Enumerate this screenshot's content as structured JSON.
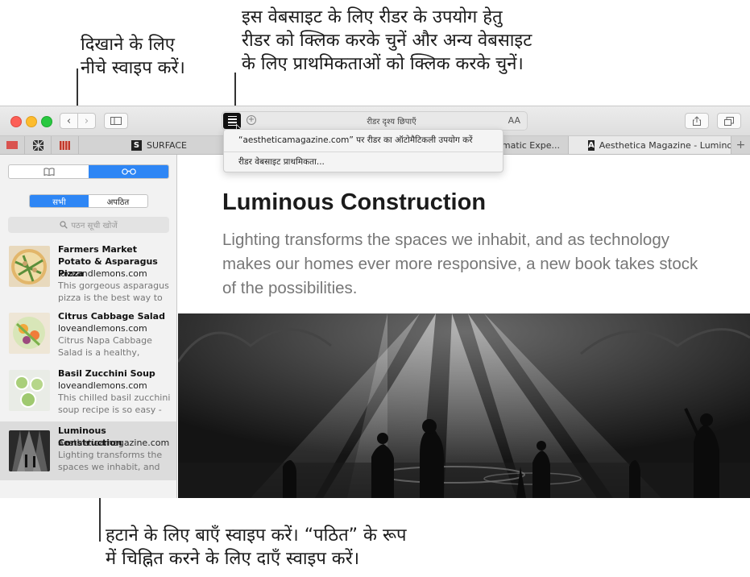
{
  "callouts": {
    "top_left": [
      "दिखाने के लिए",
      "नीचे स्वाइप करें।"
    ],
    "top_right": [
      "इस वेबसाइट के लिए रीडर के उपयोग हेतु",
      "रीडर को क्लिक करके चुनें और अन्य वेबसाइट",
      "के लिए प्राथमिकताओं को क्लिक करके चुनें।"
    ],
    "bottom": [
      "हटाने के लिए बाएँ स्वाइप करें। “पठित” के रूप",
      "में चिह्नित करने के लिए दाएँ स्वाइप करें।"
    ]
  },
  "toolbar": {
    "address_text": "रीडर दृश्य छिपाएँ",
    "text_size_label": "AA"
  },
  "tabs": [
    {
      "label": "",
      "icon": "favicon-red"
    },
    {
      "label": "",
      "icon": "favicon-pattern"
    },
    {
      "label": "",
      "icon": "favicon-grid"
    },
    {
      "label": "SURFACE",
      "icon": "S"
    },
    {
      "label": "...hromatic Expe...",
      "icon": ""
    },
    {
      "label": "Aesthetica Magazine - Lumino...",
      "icon": "A"
    }
  ],
  "reader_menu": {
    "item1": "“aestheticamagazine.com” पर रीडर का ऑटोमैटिकली उपयोग करें",
    "item2": "रीडर वेबसाइट प्राथमिकता..."
  },
  "sidebar": {
    "filters": {
      "all": "सभी",
      "unread": "अपठित"
    },
    "search_placeholder": "पठन सूची खोजें",
    "items": [
      {
        "title": "Farmers Market Potato & Asparagus Pizza",
        "domain": "loveandlemons.com",
        "desc": "This gorgeous asparagus pizza is the best way to c..."
      },
      {
        "title": "Citrus Cabbage Salad",
        "domain": "loveandlemons.com",
        "desc": "Citrus Napa Cabbage Salad is a healthy, crunch..."
      },
      {
        "title": "Basil Zucchini Soup",
        "domain": "loveandlemons.com",
        "desc": "This chilled basil zucchini soup recipe is so easy - t..."
      },
      {
        "title": "Luminous Construction",
        "domain": "aestheticamagazine.com",
        "desc": "Lighting transforms the spaces we inhabit, and as..."
      }
    ]
  },
  "article": {
    "headline": "Luminous Construction",
    "subheadline": "Lighting transforms the spaces we inhabit, and as technology makes our homes ever more responsive, a new book takes stock of the possibilities."
  },
  "colors": {
    "accent": "#2e86f5",
    "selected_row": "#dcdcdc"
  }
}
